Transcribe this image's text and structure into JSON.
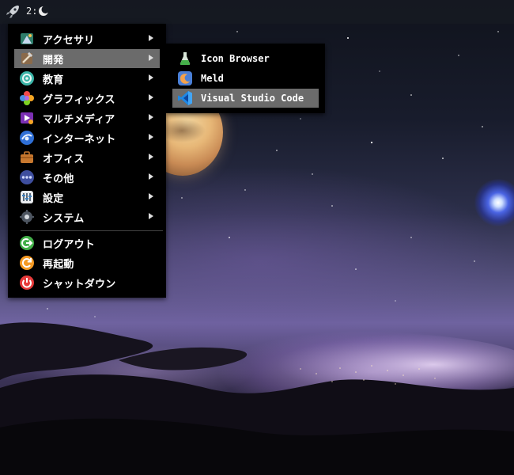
{
  "panel": {
    "workspace_label": "2:",
    "launcher_icon": "rocket-icon",
    "workspace_icon": "moon-icon"
  },
  "main_menu": {
    "items": [
      {
        "label": "アクセサリ",
        "icon": "accessories-icon",
        "has_submenu": true
      },
      {
        "label": "開発",
        "icon": "development-icon",
        "has_submenu": true,
        "active": true
      },
      {
        "label": "教育",
        "icon": "education-icon",
        "has_submenu": true
      },
      {
        "label": "グラフィックス",
        "icon": "graphics-icon",
        "has_submenu": true
      },
      {
        "label": "マルチメディア",
        "icon": "multimedia-icon",
        "has_submenu": true
      },
      {
        "label": "インターネット",
        "icon": "internet-icon",
        "has_submenu": true
      },
      {
        "label": "オフィス",
        "icon": "office-icon",
        "has_submenu": true
      },
      {
        "label": "その他",
        "icon": "other-icon",
        "has_submenu": true
      },
      {
        "label": "設定",
        "icon": "settings-icon",
        "has_submenu": true
      },
      {
        "label": "システム",
        "icon": "system-icon",
        "has_submenu": true
      },
      {
        "label": "ログアウト",
        "icon": "logout-icon",
        "has_submenu": false
      },
      {
        "label": "再起動",
        "icon": "reboot-icon",
        "has_submenu": false
      },
      {
        "label": "シャットダウン",
        "icon": "shutdown-icon",
        "has_submenu": false
      }
    ]
  },
  "sub_menu": {
    "items": [
      {
        "label": "Icon Browser",
        "icon": "icon-browser-icon"
      },
      {
        "label": "Meld",
        "icon": "meld-icon"
      },
      {
        "label": "Visual Studio Code",
        "icon": "vscode-icon",
        "highlighted": true
      }
    ]
  },
  "colors": {
    "menu_bg": "#000000",
    "highlight": "#6b6b6b",
    "panel_bg": "#161a22"
  }
}
